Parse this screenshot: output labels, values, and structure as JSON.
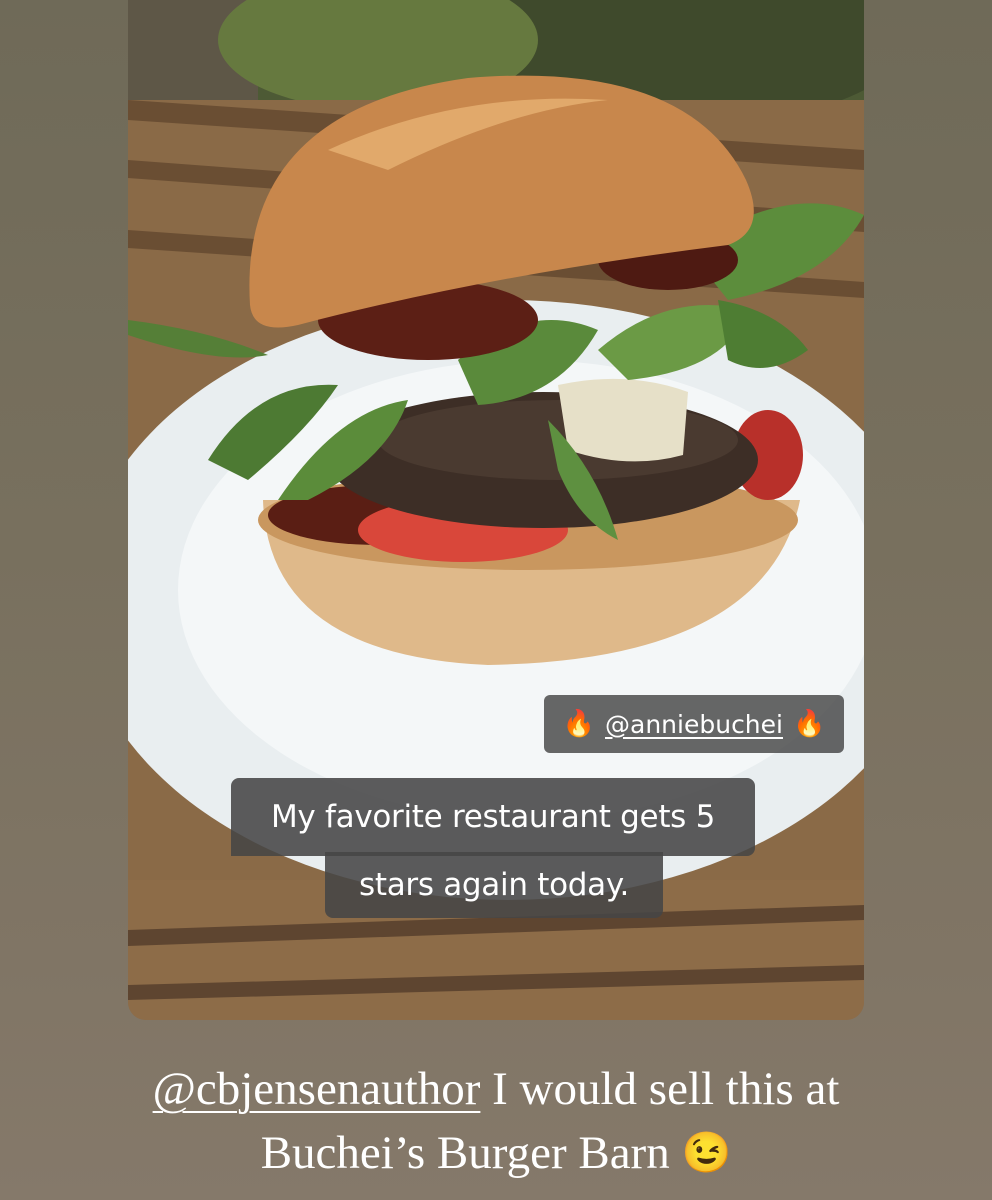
{
  "story": {
    "mention_sticker": {
      "handle": "@anniebuchei",
      "left_icon": "fire-icon",
      "right_icon": "fire-icon",
      "emoji": "🔥"
    },
    "caption": {
      "line1": "My favorite restaurant gets 5",
      "line2": "stars again today."
    }
  },
  "comment": {
    "mention": "@cbjensenauthor",
    "line1_rest": " I would sell this at",
    "line2_text": "Buchei’s Burger Barn ",
    "emoji": "😉",
    "emoji_icon": "winking-face-icon"
  },
  "colors": {
    "background": "#75705f",
    "sticker_bg": "#464646",
    "text": "#ffffff"
  }
}
